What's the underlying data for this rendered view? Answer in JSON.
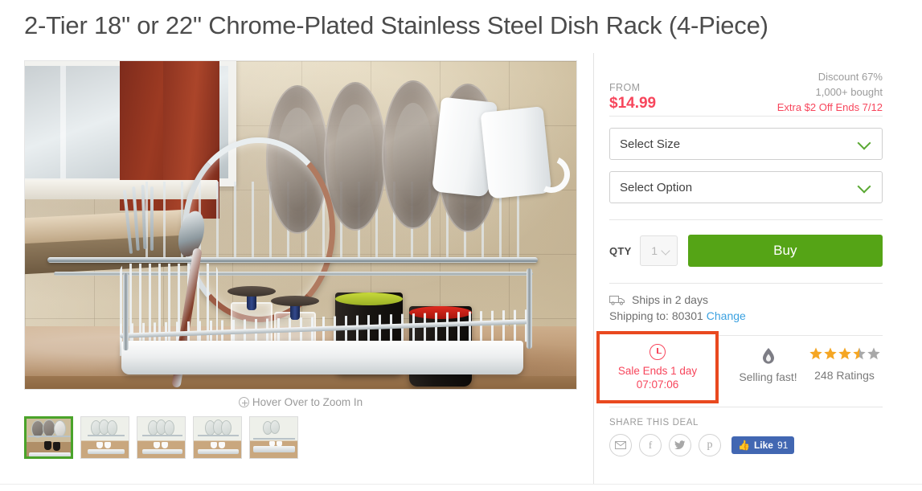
{
  "product": {
    "title": "2-Tier 18\" or 22\" Chrome-Plated Stainless Steel Dish Rack (4-Piece)"
  },
  "gallery": {
    "zoom_hint": "Hover Over to Zoom In",
    "zoom_icon": "plus-circle-icon",
    "thumbnails": [
      {
        "label": "thumbnail-1",
        "selected": true
      },
      {
        "label": "thumbnail-2",
        "selected": false
      },
      {
        "label": "thumbnail-3",
        "selected": false
      },
      {
        "label": "thumbnail-4",
        "selected": false
      },
      {
        "label": "thumbnail-5",
        "selected": false
      }
    ]
  },
  "pricing": {
    "from_label": "FROM",
    "price": "$14.99",
    "discount": "Discount 67%",
    "bought": "1,000+ bought",
    "extra_offer": "Extra $2 Off Ends 7/12",
    "price_color": "#f7465c"
  },
  "options": {
    "size_select": "Select Size",
    "option_select": "Select Option",
    "chevron_icon": "chevron-down-icon",
    "chevron_color": "#5aa832"
  },
  "purchase": {
    "qty_label": "QTY",
    "qty_value": "1",
    "buy_label": "Buy",
    "buy_color": "#55a416"
  },
  "shipping": {
    "truck_icon": "truck-icon",
    "ships_in": "Ships in 2 days",
    "shipping_to": "Shipping to: 80301",
    "change_link": "Change",
    "link_color": "#3ba1e0"
  },
  "info_strip": {
    "sale": {
      "clock_icon": "clock-icon",
      "line1": "Sale Ends 1 day",
      "line2": "07:07:06",
      "highlight_color": "#e9491f"
    },
    "selling": {
      "flame_icon": "flame-icon",
      "label": "Selling fast!"
    },
    "ratings": {
      "stars_filled": 3.5,
      "stars_total": 5,
      "star_color": "#f5a623",
      "star_empty_color": "#a8a8a8",
      "label": "248 Ratings"
    }
  },
  "share": {
    "title": "SHARE THIS DEAL",
    "buttons": [
      {
        "name": "email-share-icon",
        "glyph": "✉"
      },
      {
        "name": "facebook-share-icon",
        "glyph": "f"
      },
      {
        "name": "twitter-share-icon",
        "glyph": "ᴠ"
      },
      {
        "name": "pinterest-share-icon",
        "glyph": "ᴘ"
      }
    ],
    "facebook_like": {
      "icon": "thumbs-up-icon",
      "label": "Like",
      "count": "91",
      "color": "#4267b2"
    }
  }
}
